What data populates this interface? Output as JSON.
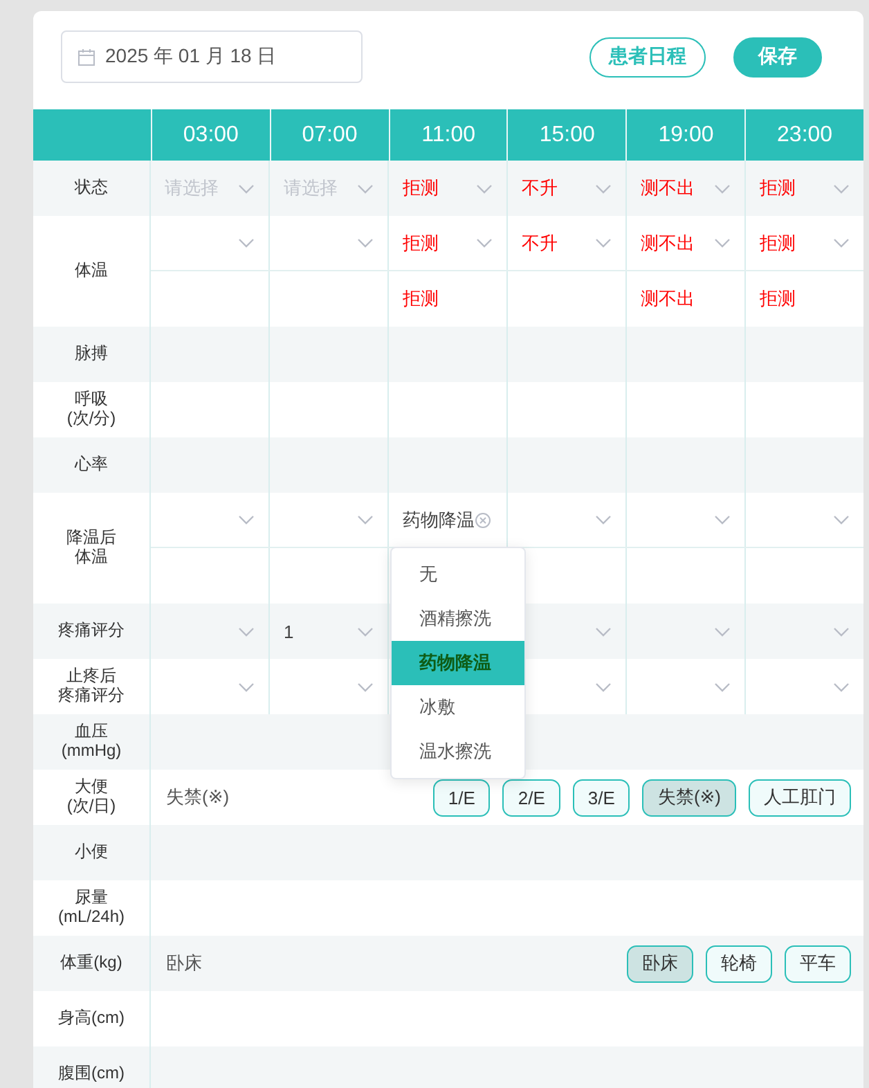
{
  "date_field": {
    "value": "2025 年 01 月 18 日"
  },
  "buttons": [
    {
      "label": "患者日程",
      "kind": "outline"
    },
    {
      "label": "保存",
      "kind": "primary"
    }
  ],
  "table": {
    "columns": [
      "03:00",
      "07:00",
      "11:00",
      "15:00",
      "19:00",
      "23:00"
    ],
    "rows": [
      {
        "label": [
          "状态"
        ],
        "kind": "cells",
        "striped": true,
        "lines": [
          [
            {
              "kind": "select",
              "placeholder": "请选择"
            },
            {
              "kind": "select",
              "placeholder": "请选择"
            },
            {
              "kind": "select",
              "value": "拒测",
              "alert": true
            },
            {
              "kind": "select",
              "value": "不升",
              "alert": true
            },
            {
              "kind": "select",
              "value": "测不出",
              "alert": true
            },
            {
              "kind": "select",
              "value": "拒测",
              "alert": true
            }
          ]
        ]
      },
      {
        "label": [
          "体温"
        ],
        "kind": "cells",
        "striped": false,
        "lines": [
          [
            {
              "kind": "select"
            },
            {
              "kind": "select"
            },
            {
              "kind": "select",
              "value": "拒测",
              "alert": true
            },
            {
              "kind": "select",
              "value": "不升",
              "alert": true
            },
            {
              "kind": "select",
              "value": "测不出",
              "alert": true
            },
            {
              "kind": "select",
              "value": "拒测",
              "alert": true
            }
          ],
          [
            {
              "kind": "empty"
            },
            {
              "kind": "empty"
            },
            {
              "kind": "text",
              "value": "拒测",
              "alert": true
            },
            {
              "kind": "empty"
            },
            {
              "kind": "text",
              "value": "测不出",
              "alert": true
            },
            {
              "kind": "text",
              "value": "拒测",
              "alert": true
            }
          ]
        ]
      },
      {
        "label": [
          "脉搏"
        ],
        "kind": "cells",
        "striped": true,
        "lines": [
          [
            {
              "kind": "empty"
            },
            {
              "kind": "empty"
            },
            {
              "kind": "empty"
            },
            {
              "kind": "empty"
            },
            {
              "kind": "empty"
            },
            {
              "kind": "empty"
            }
          ]
        ]
      },
      {
        "label": [
          "呼吸",
          "(次/分)"
        ],
        "kind": "cells",
        "striped": false,
        "lines": [
          [
            {
              "kind": "empty"
            },
            {
              "kind": "empty"
            },
            {
              "kind": "empty"
            },
            {
              "kind": "empty"
            },
            {
              "kind": "empty"
            },
            {
              "kind": "empty"
            }
          ]
        ]
      },
      {
        "label": [
          "心率"
        ],
        "kind": "cells",
        "striped": true,
        "lines": [
          [
            {
              "kind": "empty"
            },
            {
              "kind": "empty"
            },
            {
              "kind": "empty"
            },
            {
              "kind": "empty"
            },
            {
              "kind": "empty"
            },
            {
              "kind": "empty"
            }
          ]
        ]
      },
      {
        "label": [
          "降温后",
          "体温"
        ],
        "kind": "cells",
        "striped": false,
        "lines": [
          [
            {
              "kind": "select"
            },
            {
              "kind": "select"
            },
            {
              "kind": "select",
              "value": "药物降温",
              "clearable": true,
              "expanded": true,
              "options": [
                {
                  "label": "无",
                  "selected": false
                },
                {
                  "label": "酒精擦洗",
                  "selected": false
                },
                {
                  "label": "药物降温",
                  "selected": true
                },
                {
                  "label": "冰敷",
                  "selected": false
                },
                {
                  "label": "温水擦洗",
                  "selected": false
                }
              ]
            },
            {
              "kind": "select"
            },
            {
              "kind": "select"
            },
            {
              "kind": "select"
            }
          ],
          [
            {
              "kind": "empty"
            },
            {
              "kind": "empty"
            },
            {
              "kind": "empty"
            },
            {
              "kind": "empty"
            },
            {
              "kind": "empty"
            },
            {
              "kind": "empty"
            }
          ]
        ]
      },
      {
        "label": [
          "疼痛评分"
        ],
        "kind": "cells",
        "striped": true,
        "lines": [
          [
            {
              "kind": "select"
            },
            {
              "kind": "select",
              "value": "1"
            },
            {
              "kind": "empty"
            },
            {
              "kind": "select"
            },
            {
              "kind": "select"
            },
            {
              "kind": "select"
            }
          ]
        ]
      },
      {
        "label": [
          "止疼后",
          "疼痛评分"
        ],
        "kind": "cells",
        "striped": false,
        "lines": [
          [
            {
              "kind": "select"
            },
            {
              "kind": "select"
            },
            {
              "kind": "empty"
            },
            {
              "kind": "select"
            },
            {
              "kind": "select"
            },
            {
              "kind": "select"
            }
          ]
        ]
      },
      {
        "label": [
          "血压",
          "(mmHg)"
        ],
        "kind": "wide",
        "striped": true
      },
      {
        "label": [
          "大便",
          "(次/日)"
        ],
        "kind": "wide",
        "striped": false,
        "value": "失禁(※)",
        "chips": [
          {
            "label": "1/E",
            "selected": false
          },
          {
            "label": "2/E",
            "selected": false
          },
          {
            "label": "3/E",
            "selected": false
          },
          {
            "label": "失禁(※)",
            "selected": true
          },
          {
            "label": "人工肛门",
            "selected": false
          }
        ]
      },
      {
        "label": [
          "小便"
        ],
        "kind": "wide",
        "striped": true
      },
      {
        "label": [
          "尿量",
          "(mL/24h)"
        ],
        "kind": "wide",
        "striped": false
      },
      {
        "label": [
          "体重(kg)"
        ],
        "kind": "wide",
        "striped": true,
        "value": "卧床",
        "chips": [
          {
            "label": "卧床",
            "selected": true
          },
          {
            "label": "轮椅",
            "selected": false
          },
          {
            "label": "平车",
            "selected": false
          }
        ]
      },
      {
        "label": [
          "身高(cm)"
        ],
        "kind": "wide",
        "striped": false
      },
      {
        "label": [
          "腹围(cm)"
        ],
        "kind": "wide",
        "striped": true
      }
    ]
  }
}
